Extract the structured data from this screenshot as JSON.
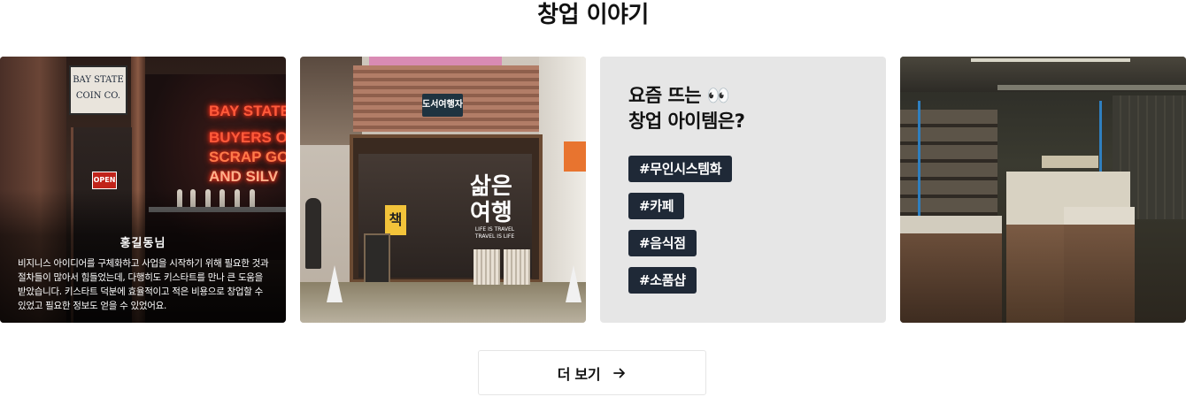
{
  "section": {
    "title": "창업 이야기"
  },
  "cards": {
    "card1": {
      "image_description": "storefront-photo",
      "image_sign": "BAY STATE COIN CO.",
      "neon_lines": [
        "BAY STATE",
        "BUYERS OF",
        "SCRAP GO",
        "AND SILV"
      ],
      "open_sign": "OPEN",
      "reviewer_name": "홍길동님",
      "review_text": "비지니스 아이디어를 구체화하고 사업을 시작하기 위해 필요한 것과 절차들이 많아서 힘들었는데, 다행히도 키스타트를 만나 큰 도움을 받았습니다. 키스타트 덕분에 효율적이고 적은 비용으로 창업할 수 있었고 필요한 정보도 얻을 수 있었어요."
    },
    "card2": {
      "image_description": "bookshop-storefront-photo",
      "nameplate": "도서여행자",
      "glass_word_line1": "삶은",
      "glass_word_line2": "여행",
      "glass_sub": "LIFE IS TRAVEL TRAVEL IS LIFE",
      "yellow_char": "책"
    },
    "card3": {
      "title_line1": "요즘 뜨는 👀",
      "title_line2": "창업 아이템은?",
      "tags": [
        "#무인시스템화",
        "#카페",
        "#음식점",
        "#소품샵"
      ],
      "background": "#e6e6e6",
      "tag_color": "#1f2937"
    },
    "card4": {
      "image_description": "store-interior-photo"
    }
  },
  "more_button": {
    "label": "더 보기",
    "icon": "arrow-right-icon"
  }
}
